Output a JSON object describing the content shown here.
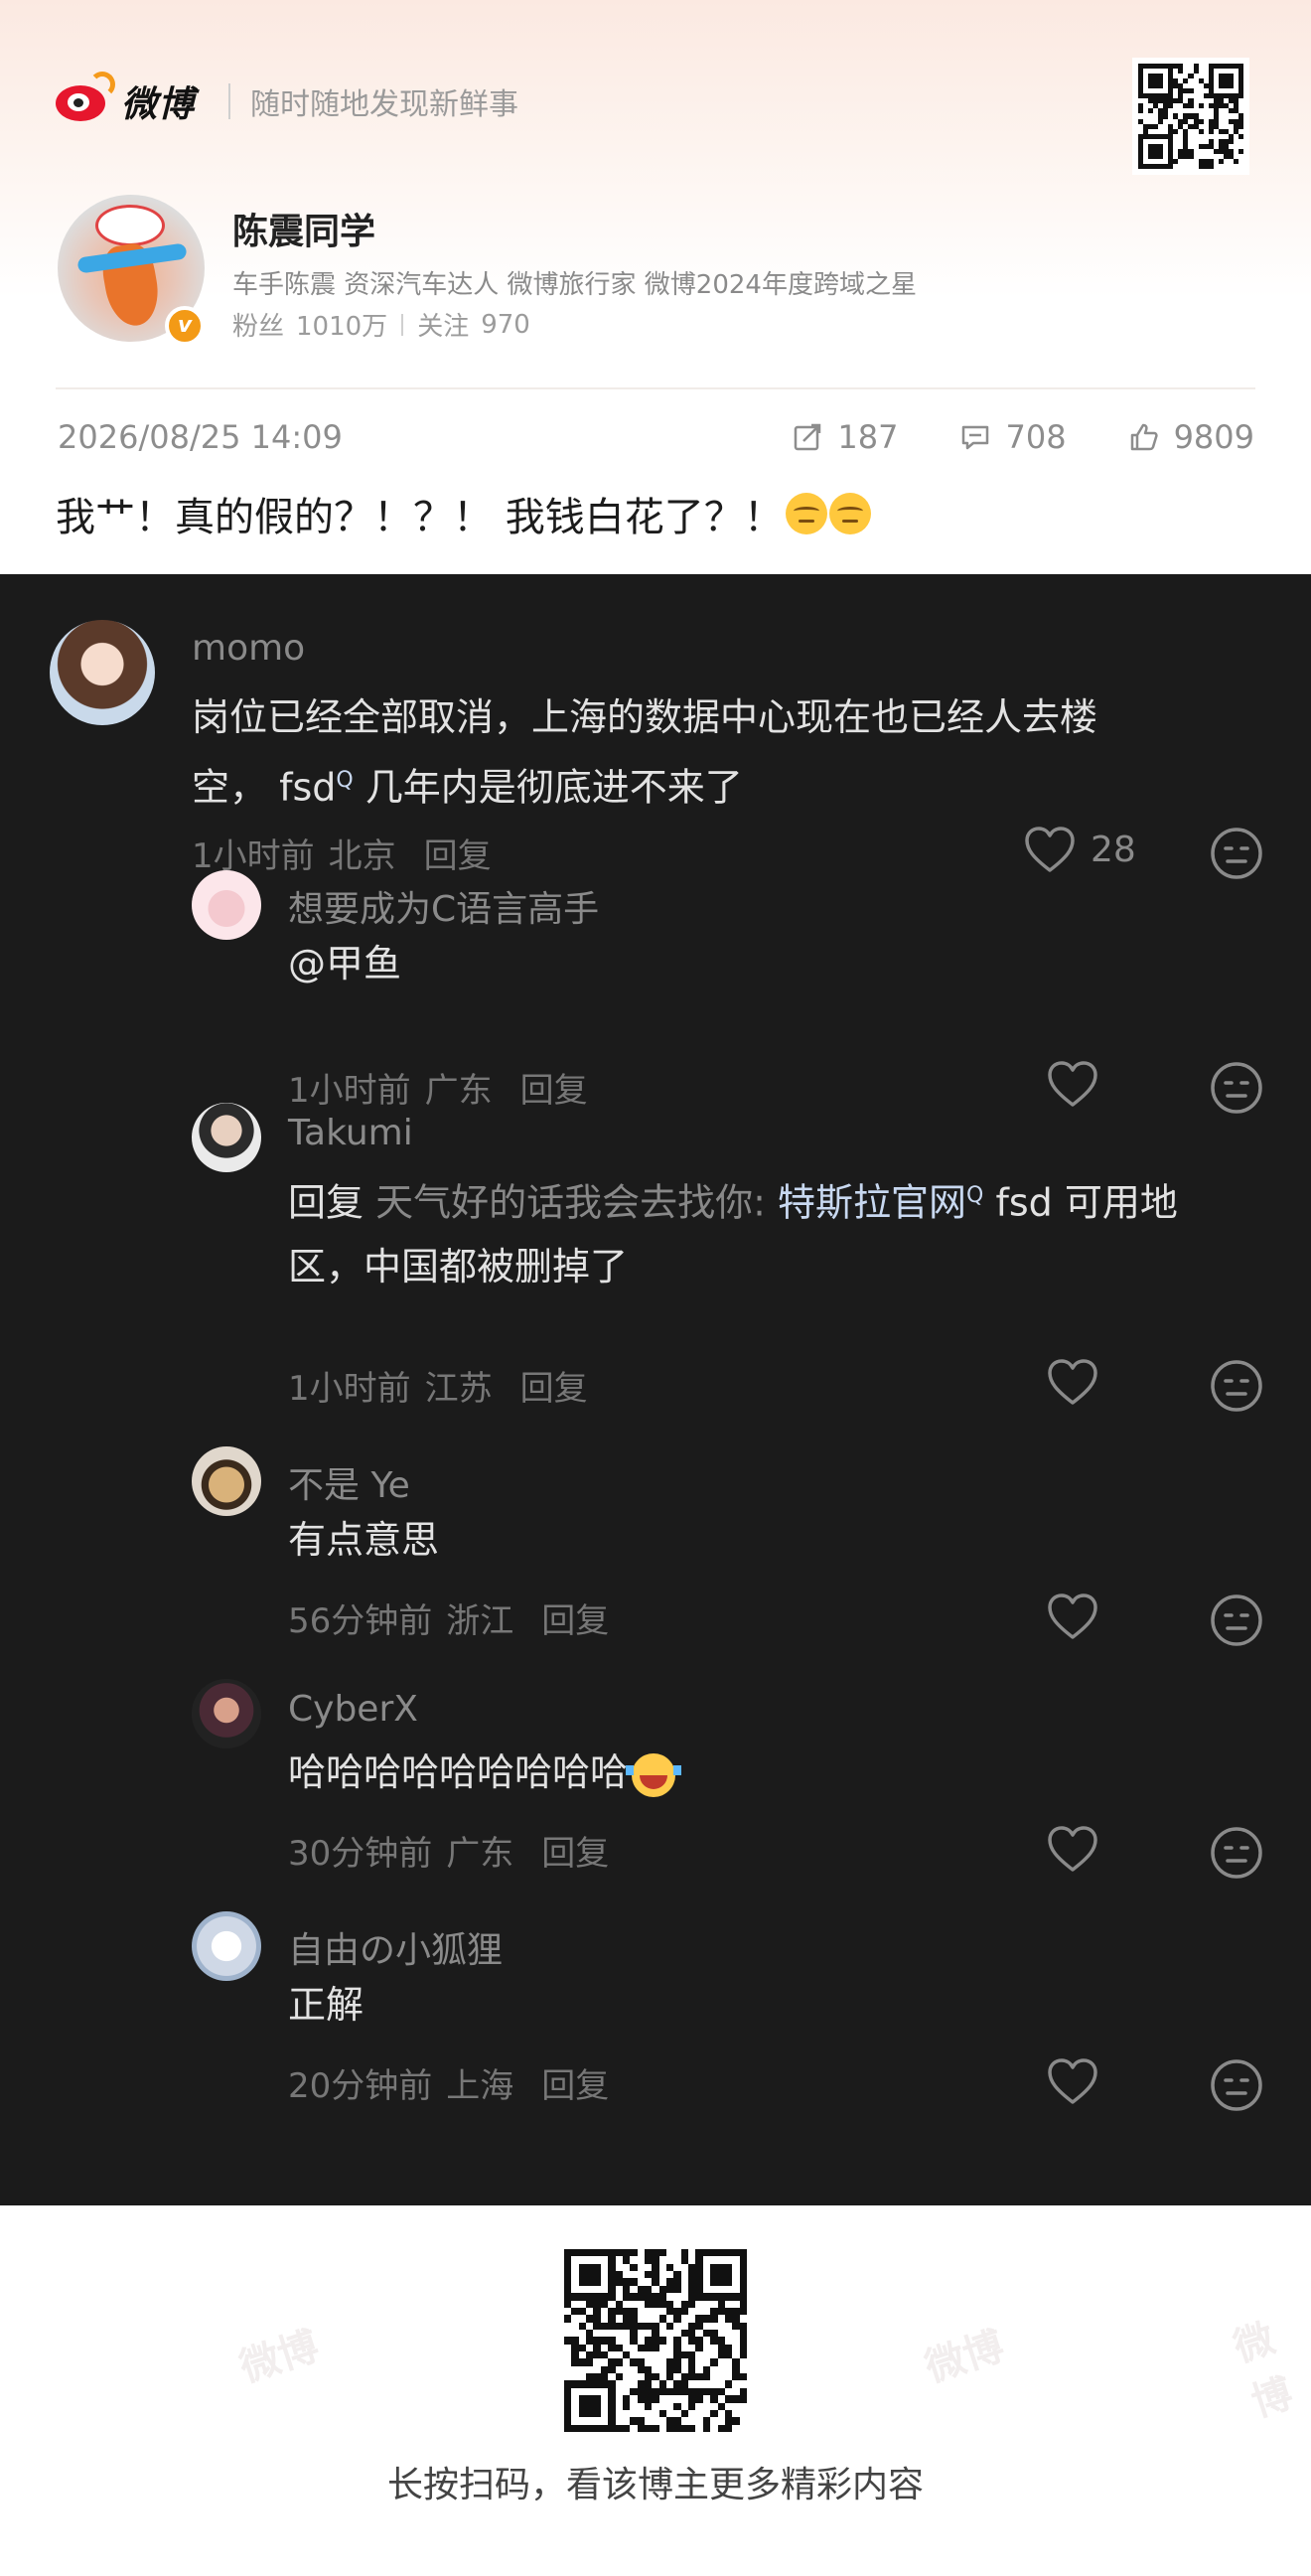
{
  "header": {
    "brand_name": "微博",
    "slogan": "随时随地发现新鲜事"
  },
  "profile": {
    "name": "陈震同学",
    "verified_badge": "v",
    "description": "车手陈震 资深汽车达人  微博旅行家 微博2024年度跨域之星",
    "fans_label": "粉丝",
    "fans_count": "1010万",
    "following_label": "关注",
    "following_count": "970"
  },
  "post": {
    "date": "2026/08/25 14:09",
    "reposts": "187",
    "comments": "708",
    "likes": "9809",
    "text": "我艹！真的假的？！？！ 我钱白花了？！"
  },
  "comments": [
    {
      "name": "momo",
      "text_line1": "岗位已经全部取消，上海的数据中心现在也已经人去楼",
      "text_line2_pre": "空， fsd",
      "text_line2_post": " 几年内是彻底进不来了",
      "time": "1小时前",
      "location": "北京",
      "reply_label": "回复",
      "likes": "28"
    },
    {
      "name": "想要成为C语言高手",
      "text": "@甲鱼",
      "time": "1小时前",
      "location": "广东",
      "reply_label": "回复"
    },
    {
      "name": "Takumi",
      "reply_prefix": "回复",
      "reply_target": "天气好的话我会去找你:",
      "link_text": "特斯拉官网",
      "text_line1_post": " fsd 可用地",
      "text_line2": "区，中国都被删掉了",
      "time": "1小时前",
      "location": "江苏",
      "reply_label": "回复"
    },
    {
      "name": "不是 Ye",
      "text": "有点意思",
      "time": "56分钟前",
      "location": "浙江",
      "reply_label": "回复"
    },
    {
      "name": "CyberX",
      "text": "哈哈哈哈哈哈哈哈哈",
      "time": "30分钟前",
      "location": "广东",
      "reply_label": "回复"
    },
    {
      "name": "自由の小狐狸",
      "text": "正解",
      "time": "20分钟前",
      "location": "上海",
      "reply_label": "回复"
    }
  ],
  "search_marker": "Q",
  "footer": {
    "caption": "长按扫码，看该博主更多精彩内容"
  },
  "watermark_text": "微博",
  "colors": {
    "brand_red": "#e6162d",
    "verified_orange": "#f39a16",
    "comment_bg": "#1b1b1b",
    "link_blue": "#c8d8f0"
  },
  "icons": [
    "weibo-logo-icon",
    "repost-icon",
    "comment-icon",
    "thumb-up-icon",
    "heart-icon",
    "face-icon",
    "qr-code-icon"
  ]
}
